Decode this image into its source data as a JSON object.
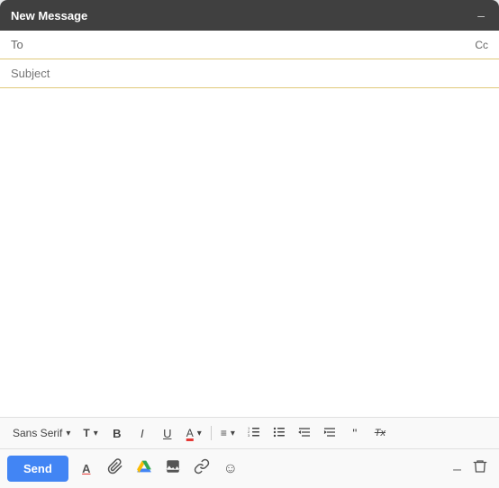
{
  "header": {
    "title": "New Message",
    "minimize_label": "–",
    "close_label": "✕"
  },
  "to_field": {
    "label": "To",
    "placeholder": "",
    "cc_label": "Cc"
  },
  "subject_field": {
    "label": "Subject",
    "placeholder": ""
  },
  "body": {
    "placeholder": ""
  },
  "formatting": {
    "font_family": "Sans Serif",
    "font_size_icon": "T",
    "bold_label": "B",
    "italic_label": "I",
    "underline_label": "U",
    "text_color_label": "A",
    "align_label": "≡",
    "numbered_list": "1.",
    "bullet_list": "•",
    "indent_less": "←",
    "indent_more": "→",
    "quote_label": "❝",
    "clear_formatting": "Tx"
  },
  "bottom_bar": {
    "send_label": "Send",
    "font_color_label": "A",
    "attach_label": "📎",
    "drive_label": "▲",
    "photo_label": "📷",
    "link_label": "🔗",
    "emoji_label": "☺",
    "minimize_label": "–",
    "delete_label": "🗑"
  }
}
